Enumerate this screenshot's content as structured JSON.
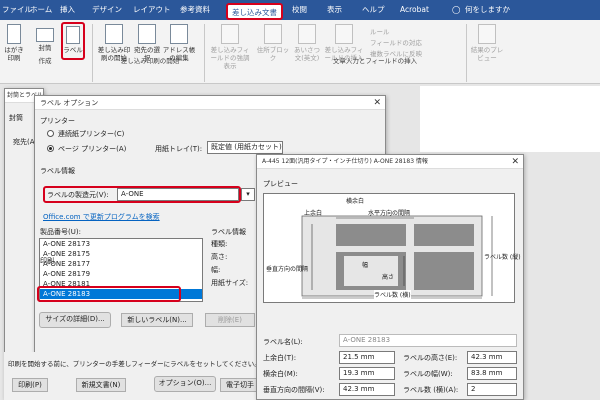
{
  "ribbon": {
    "tabs": [
      "ファイル",
      "ホーム",
      "挿入",
      "デザイン",
      "レイアウト",
      "参考資料",
      "差し込み文書",
      "校閲",
      "表示",
      "ヘルプ",
      "Acrobat"
    ],
    "tell_me": "何をしますか",
    "create_group": {
      "label": "作成",
      "items": [
        "はがき印刷",
        "封筒",
        "ラベル"
      ]
    },
    "start_group": {
      "label": "差し込み印刷の開始",
      "items": [
        "差し込み印刷の開始",
        "宛先の選択",
        "アドレス帳の編集"
      ]
    },
    "fields_group": {
      "label": "文章入力とフィールドの挿入",
      "items": [
        "差し込みフィールドの強調表示",
        "住所ブロック",
        "あいさつ文(英文)",
        "差し込みフィールドの挿入"
      ],
      "small": [
        "ルール",
        "フィールドの対応",
        "複数ラベルに反映"
      ]
    },
    "preview_group": {
      "items": [
        "結果のプレビュー"
      ]
    }
  },
  "doc_bg": {
    "title": "封筒とラベル",
    "tab1": "封筒",
    "label_dest": "宛先(A)"
  },
  "label_options": {
    "title": "ラベル オプション",
    "printer_section": "プリンター",
    "continuous": "連続紙プリンター(C)",
    "page_printer": "ページ プリンター(A)",
    "tray_label": "用紙トレイ(T):",
    "tray_value": "既定値 (用紙カセット)",
    "label_info": "ラベル情報",
    "vendor_label": "ラベルの製造元(V):",
    "vendor_value": "A-ONE",
    "update_link": "Office.com で更新プログラムを検索",
    "product_label": "製品番号(U):",
    "products": [
      "A-ONE 28173",
      "A-ONE 28175",
      "A-ONE 28177",
      "A-ONE 28179",
      "A-ONE 28181",
      "A-ONE 28183"
    ],
    "right_info_title": "ラベル情報",
    "right_info": [
      "種類:",
      "高さ:",
      "幅:",
      "用紙サイズ:"
    ],
    "details_btn": "サイズの詳細(D)...",
    "new_label_btn": "新しいラベル(N)...",
    "delete_btn": "削除(E)",
    "print_label": "印刷",
    "footer_text": "印刷を開始する前に、プリンターの手差しフィーダーにラベルをセットしてください。",
    "print_btn": "印刷(P)",
    "new_doc_btn": "新規文書(N)",
    "options_btn": "オプション(O)...",
    "epostage_btn": "電子切手"
  },
  "info_dialog": {
    "title": "A-445 12面(汎用タイプ・インチ仕切り) A-ONE 28183 情報",
    "preview_label": "プレビュー",
    "diagram_labels": {
      "top": "上余白",
      "side": "横余白",
      "hpitch": "水平方向の間隔",
      "vpitch": "垂直方向の間隔",
      "width": "幅",
      "height": "高さ",
      "rows": "ラベル数 (縦)",
      "cols": "ラベル数 (横)"
    },
    "label_name_label": "ラベル名(L):",
    "label_name_value": "A-ONE 28183",
    "fields": [
      {
        "label": "上余白(T):",
        "value": "21.5 mm"
      },
      {
        "label": "ラベルの高さ(E):",
        "value": "42.3 mm"
      },
      {
        "label": "横余白(M):",
        "value": "19.3 mm"
      },
      {
        "label": "ラベルの幅(W):",
        "value": "83.8 mm"
      },
      {
        "label": "垂直方向の間隔(V):",
        "value": "42.3 mm"
      },
      {
        "label": "ラベル数 (横)(A):",
        "value": "2"
      }
    ]
  },
  "colors": {
    "accent": "#2b579a",
    "highlight": "#d6001c",
    "selection": "#0078d7"
  }
}
